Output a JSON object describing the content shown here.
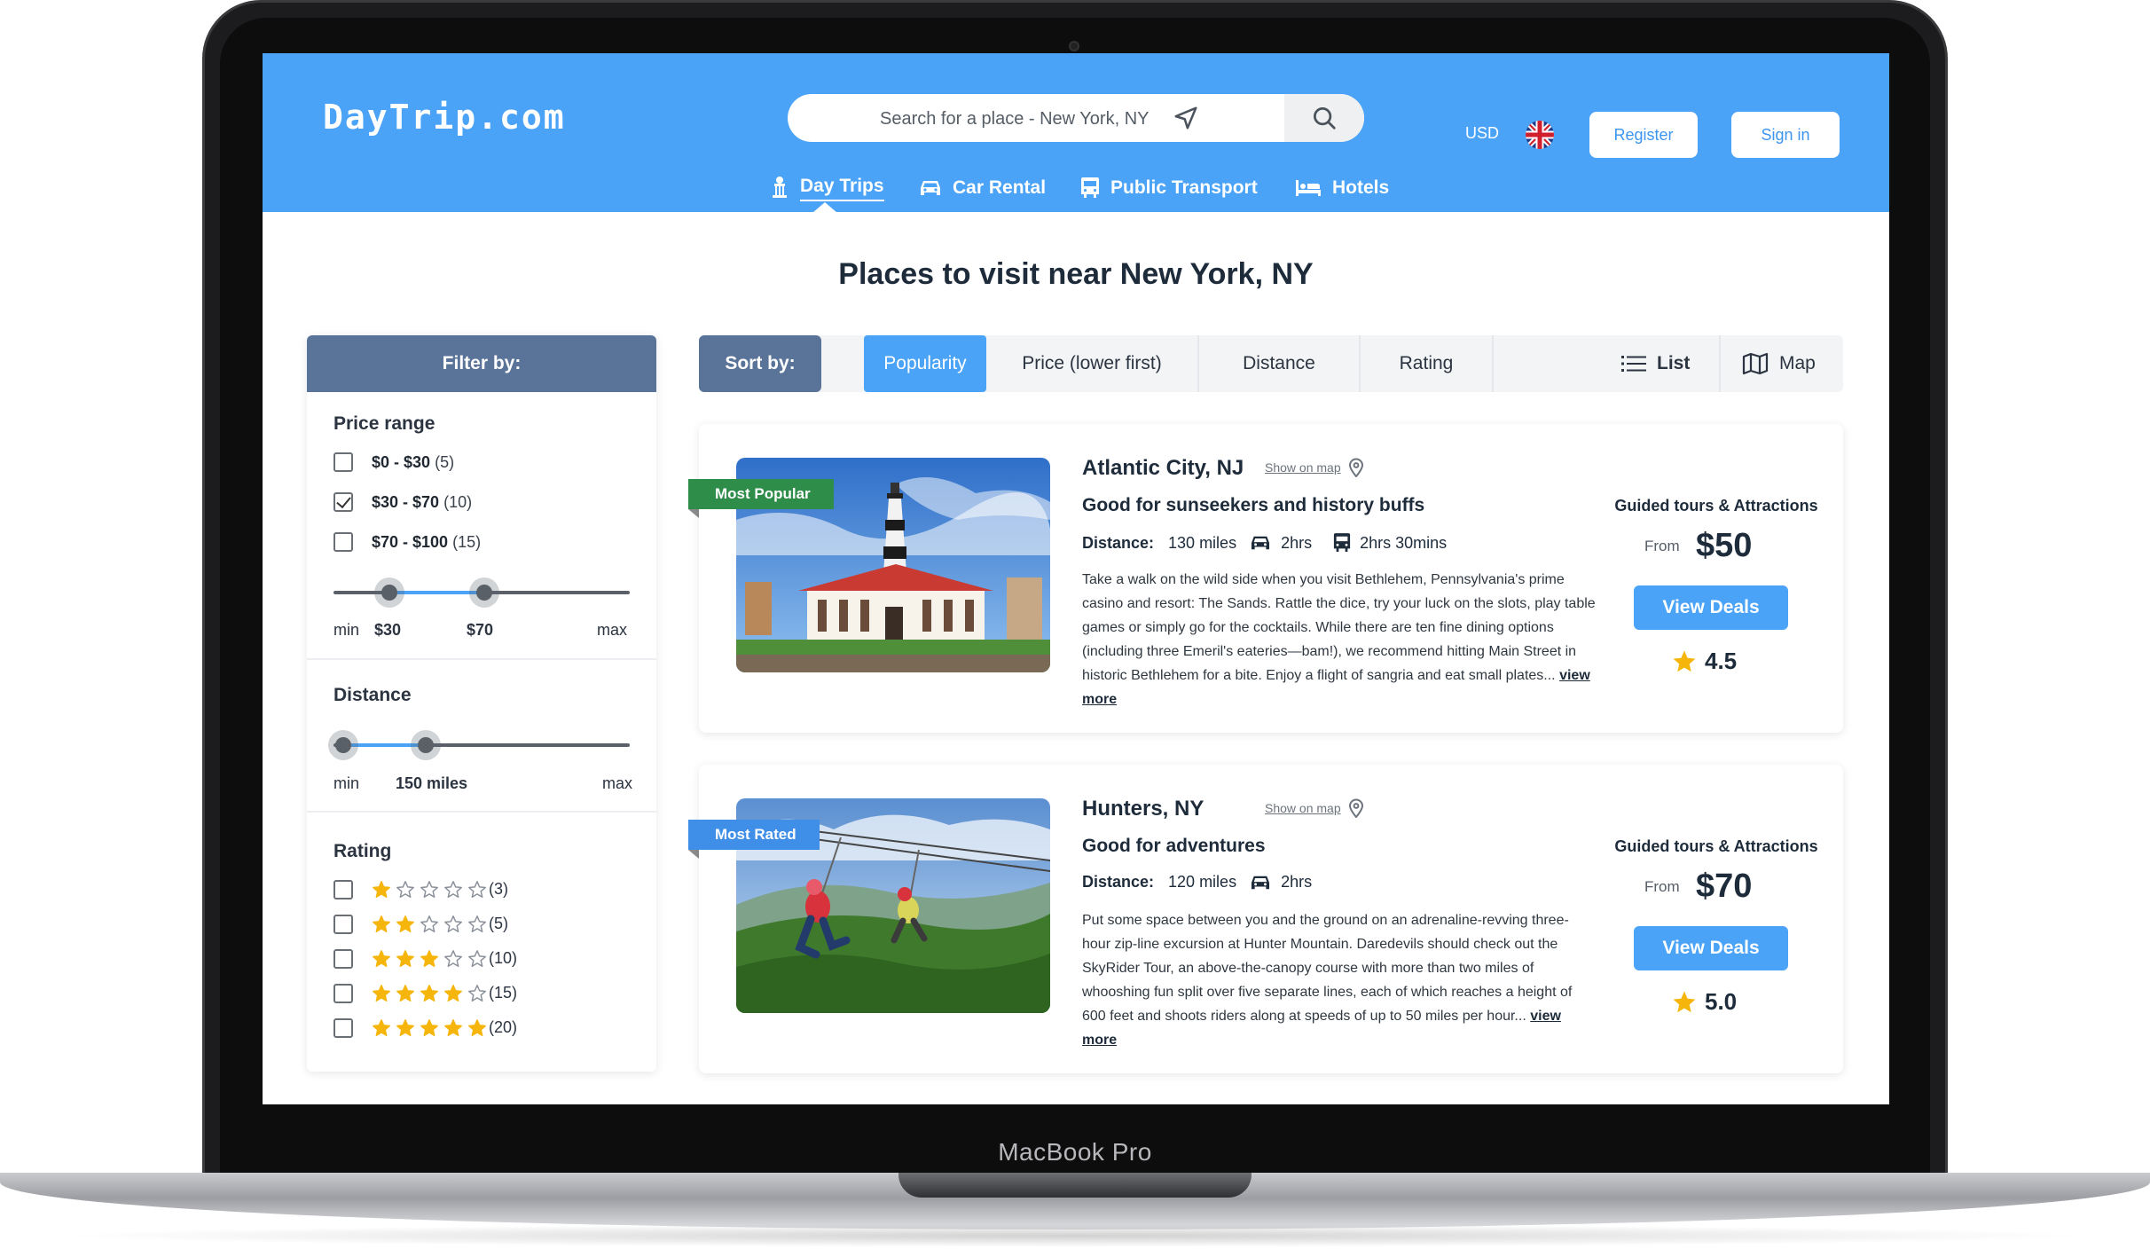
{
  "device": {
    "brand_label": "MacBook Pro"
  },
  "header": {
    "logo": "DayTrip.com",
    "search": {
      "placeholder": "Search for a place - New York, NY"
    },
    "currency": "USD",
    "register_label": "Register",
    "signin_label": "Sign in",
    "nav": [
      {
        "label": "Day Trips",
        "active": true
      },
      {
        "label": "Car Rental",
        "active": false
      },
      {
        "label": "Public Transport",
        "active": false
      },
      {
        "label": "Hotels",
        "active": false
      }
    ],
    "colors": {
      "bar": "#4aa3f6",
      "accent": "#3c95ee"
    }
  },
  "page_title": "Places to visit near New York, NY",
  "filter": {
    "heading": "Filter by:",
    "price": {
      "title": "Price range",
      "options": [
        {
          "range": "$0 - $30",
          "count": "(5)",
          "checked": false
        },
        {
          "range": "$30 - $70",
          "count": "(10)",
          "checked": true
        },
        {
          "range": "$70 - $100",
          "count": "(15)",
          "checked": false
        }
      ],
      "slider": {
        "min_label": "min",
        "max_label": "max",
        "low": "$30",
        "high": "$70"
      }
    },
    "distance": {
      "title": "Distance",
      "slider": {
        "min_label": "min",
        "max_label": "max",
        "value": "150 miles"
      }
    },
    "rating": {
      "title": "Rating",
      "options": [
        {
          "stars": 1,
          "count": "(3)"
        },
        {
          "stars": 2,
          "count": "(5)"
        },
        {
          "stars": 3,
          "count": "(10)"
        },
        {
          "stars": 4,
          "count": "(15)"
        },
        {
          "stars": 5,
          "count": "(20)"
        }
      ]
    }
  },
  "sort": {
    "label": "Sort by:",
    "options": [
      "Popularity",
      "Price (lower first)",
      "Distance",
      "Rating"
    ],
    "active": "Popularity",
    "view_list": "List",
    "view_map": "Map"
  },
  "results": [
    {
      "title": "Atlantic City, NJ",
      "show_on_map": "Show on map",
      "ribbon": "Most Popular",
      "subtitle": "Good for sunseekers and history buffs",
      "distance_label": "Distance:",
      "distance": "130 miles",
      "car_time": "2hrs",
      "bus_time": "2hrs 30mins",
      "description": "Take a walk on the wild side when you visit Bethlehem, Pennsylvania's prime casino and resort: The Sands. Rattle the dice, try your luck on the slots, play table games or simply go for the cocktails. While there are ten fine dining options (including three Emeril's eateries—bam!), we recommend hitting Main Street in historic Bethlehem for a bite. Enjoy a flight of sangria and eat small plates...",
      "view_more": "view more",
      "category": "Guided tours & Attractions",
      "from_label": "From",
      "price": "$50",
      "deals_label": "View Deals",
      "rating": "4.5"
    },
    {
      "title": "Hunters, NY",
      "show_on_map": "Show on map",
      "ribbon": "Most Rated",
      "subtitle": "Good for adventures",
      "distance_label": "Distance:",
      "distance": "120 miles",
      "car_time": "2hrs",
      "description": "Put some space between you and the ground on an adrenaline-revving three-hour zip-line excursion at Hunter Mountain. Daredevils should check out the SkyRider Tour, an above-the-canopy course with more than two miles of whooshing fun split over five separate lines, each of which reaches a height of 600 feet and shoots riders along at speeds of up to 50 miles per hour...",
      "view_more": "view more",
      "category": "Guided tours & Attractions",
      "from_label": "From",
      "price": "$70",
      "deals_label": "View Deals",
      "rating": "5.0"
    }
  ]
}
